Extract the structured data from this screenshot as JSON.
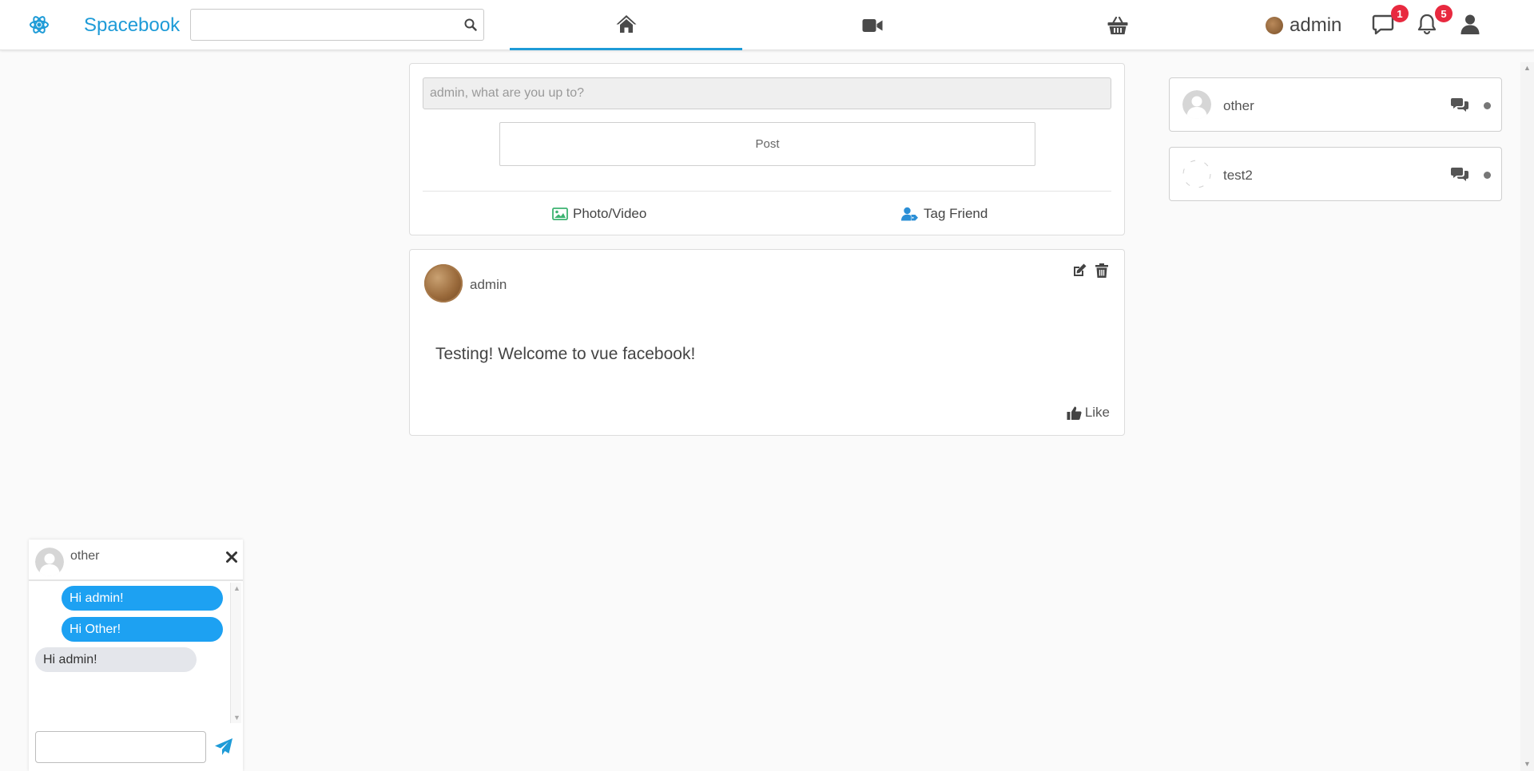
{
  "colors": {
    "brand": "#1e9bd7",
    "bubble_mine": "#1da1f2",
    "bubble_theirs": "#e4e6eb",
    "badge": "#e8293f"
  },
  "navbar": {
    "brand_name": "Spacebook",
    "brand_icon": "atom-icon",
    "search": {
      "value": "",
      "icon": "search-icon"
    },
    "tabs": [
      {
        "icon": "home-icon",
        "active": true
      },
      {
        "icon": "video-camera-icon",
        "active": false
      },
      {
        "icon": "shopping-basket-icon",
        "active": false
      }
    ],
    "user_name": "admin",
    "messages_badge": "1",
    "notifications_badge": "5"
  },
  "composer": {
    "placeholder": "admin, what are you up to?",
    "post_label": "Post",
    "photo_video_label": "Photo/Video",
    "tag_friend_label": "Tag Friend"
  },
  "post": {
    "author": "admin",
    "text": "Testing! Welcome to vue facebook!",
    "like_label": "Like"
  },
  "contacts": [
    {
      "name": "other"
    },
    {
      "name": "test2"
    }
  ],
  "chat": {
    "title": "other",
    "messages": [
      {
        "text": "Hi admin!",
        "mine": true
      },
      {
        "text": "Hi Other!",
        "mine": true
      },
      {
        "text": "Hi admin!",
        "mine": false
      }
    ],
    "input_value": ""
  }
}
